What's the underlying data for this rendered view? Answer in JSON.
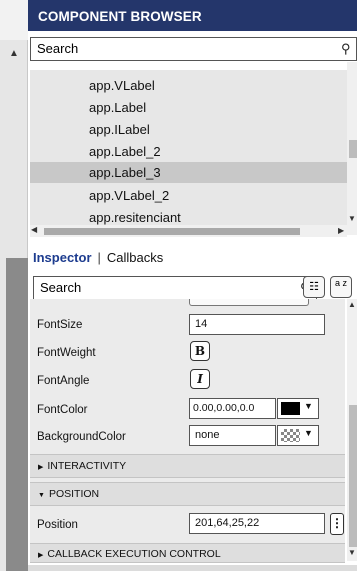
{
  "component_browser": {
    "title": "COMPONENT BROWSER",
    "search_value": "Search",
    "items": [
      {
        "label": "app.VLabel",
        "selected": false
      },
      {
        "label": "app.Label",
        "selected": false
      },
      {
        "label": "app.ILabel",
        "selected": false
      },
      {
        "label": "app.Label_2",
        "selected": false
      },
      {
        "label": "app.Label_3",
        "selected": true
      },
      {
        "label": "app.VLabel_2",
        "selected": false
      },
      {
        "label": "app.resitenciant",
        "selected": false
      }
    ]
  },
  "inspector": {
    "tab_inspector": "Inspector",
    "tab_separator": "|",
    "tab_callbacks": "Callbacks",
    "search_value": "Search",
    "tree_icon": "list-tree-icon",
    "sort_icon": "sort-az-icon",
    "sort_label": "a z",
    "properties": {
      "font_size_label": "FontSize",
      "font_size_value": "14",
      "font_weight_label": "FontWeight",
      "font_weight_value": "B",
      "font_angle_label": "FontAngle",
      "font_angle_value": "I",
      "font_color_label": "FontColor",
      "font_color_value": "0.00,0.00,0.0",
      "font_color_swatch": "#000000",
      "background_color_label": "BackgroundColor",
      "background_color_value": "none",
      "position_label": "Position",
      "position_value": "201,64,25,22",
      "ellipsis": "⋮"
    },
    "sections": {
      "interactivity": "INTERACTIVITY",
      "position": "POSITION",
      "callback_execution_control": "CALLBACK EXECUTION CONTROL"
    }
  },
  "colors": {
    "header_bg": "#24366b",
    "selected_row": "#c8c8c8",
    "inspector_tab_active": "#1d3c8f"
  }
}
